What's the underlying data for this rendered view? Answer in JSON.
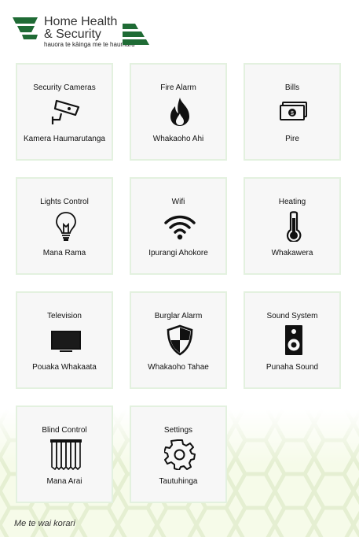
{
  "header": {
    "title_line1": "Home Health",
    "title_line2": "& Security",
    "tagline": "hauora te kāinga me te haumaru"
  },
  "tiles": [
    {
      "label_en": "Security Cameras",
      "label_mi": "Kamera Haumarutanga",
      "icon": "security-camera-icon"
    },
    {
      "label_en": "Fire Alarm",
      "label_mi": "Whakaoho Ahi",
      "icon": "fire-icon"
    },
    {
      "label_en": "Bills",
      "label_mi": "Pire",
      "icon": "bills-icon"
    },
    {
      "label_en": "Lights Control",
      "label_mi": "Mana Rama",
      "icon": "light-bulb-icon"
    },
    {
      "label_en": "Wifi",
      "label_mi": "Ipurangi Ahokore",
      "icon": "wifi-icon"
    },
    {
      "label_en": "Heating",
      "label_mi": "Whakawera",
      "icon": "thermometer-icon"
    },
    {
      "label_en": "Television",
      "label_mi": "Pouaka Whakaata",
      "icon": "television-icon"
    },
    {
      "label_en": "Burglar Alarm",
      "label_mi": "Whakaoho Tahae",
      "icon": "shield-icon"
    },
    {
      "label_en": "Sound System",
      "label_mi": "Punaha Sound",
      "icon": "speaker-icon"
    },
    {
      "label_en": "Blind Control",
      "label_mi": "Mana Arai",
      "icon": "blinds-icon"
    },
    {
      "label_en": "Settings",
      "label_mi": "Tautuhinga",
      "icon": "gear-icon"
    }
  ],
  "footer": {
    "text": "Me te wai korari"
  },
  "colors": {
    "brand_green": "#1f6b35",
    "tile_bg": "#f7f7f7",
    "tile_border": "#e3f1df",
    "hex_pattern": "#eaf4c8"
  }
}
